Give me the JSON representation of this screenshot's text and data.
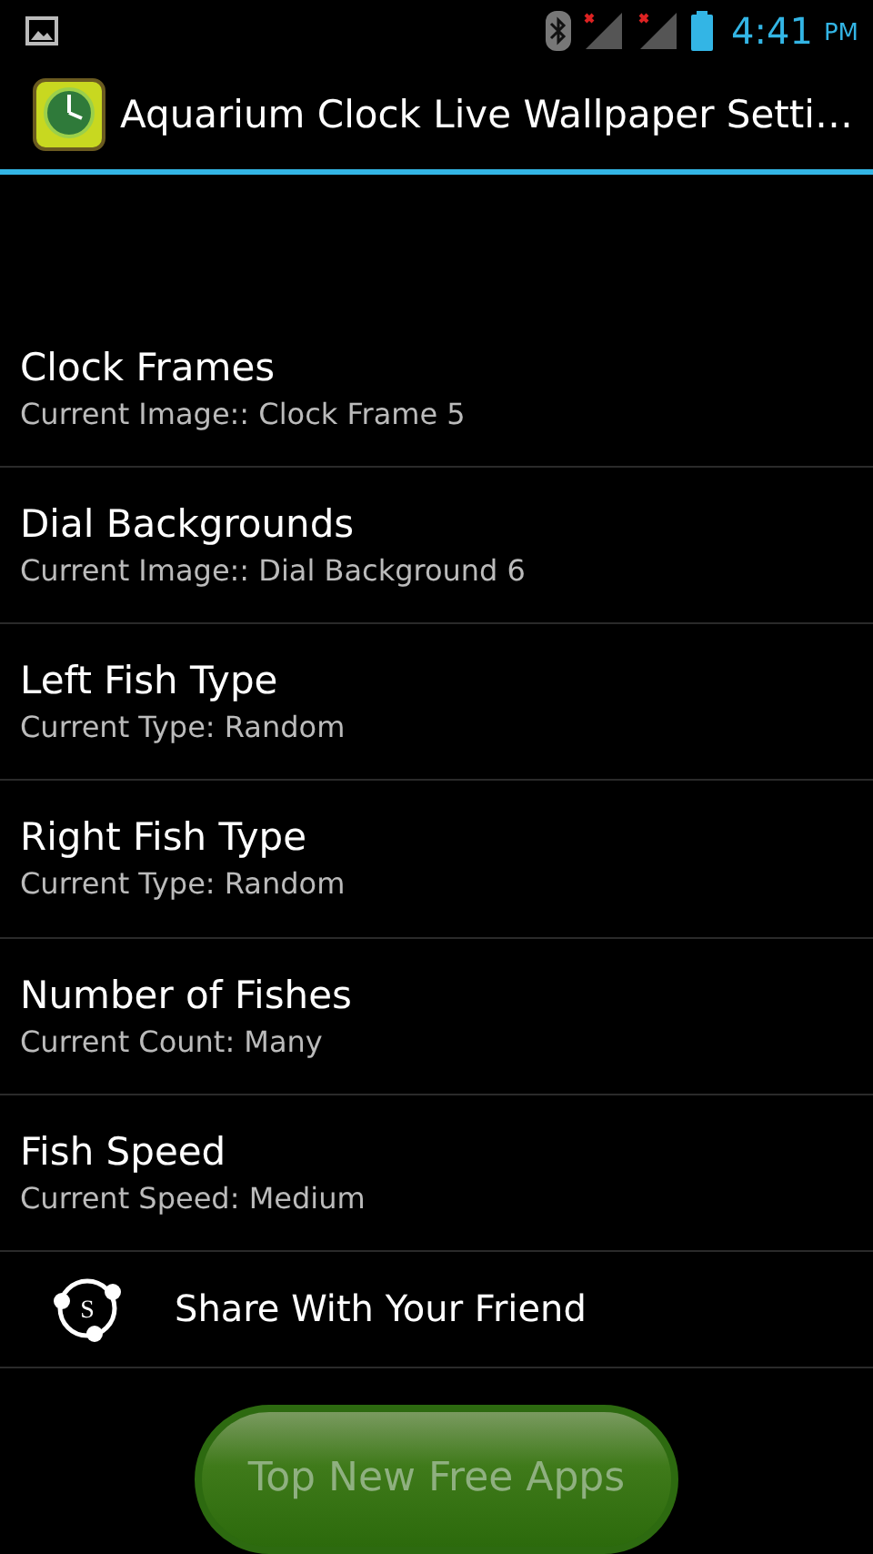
{
  "status_bar": {
    "time": "4:41",
    "ampm": "PM"
  },
  "action_bar": {
    "title": "Aquarium Clock Live Wallpaper Setti…"
  },
  "settings": [
    {
      "title": "Clock Frames",
      "summary": "Current Image:: Clock Frame 5"
    },
    {
      "title": "Dial Backgrounds",
      "summary": "Current Image:: Dial Background 6"
    },
    {
      "title": "Left Fish Type",
      "summary": "Current Type: Random"
    },
    {
      "title": "Right Fish Type",
      "summary": "Current Type: Random"
    },
    {
      "title": "Number of Fishes",
      "summary": "Current Count: Many"
    },
    {
      "title": "Fish Speed",
      "summary": "Current Speed: Medium"
    }
  ],
  "share": {
    "icon_letter": "S",
    "label": "Share With Your Friend"
  },
  "promo_button": {
    "label": "Top New Free Apps"
  }
}
